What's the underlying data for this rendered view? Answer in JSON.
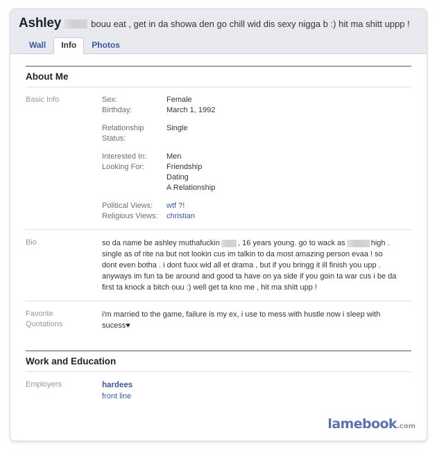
{
  "header": {
    "profile_name": "Ashley",
    "name_redacted": true,
    "status_text": "bouu eat , get in da showa den go chill wid dis sexy nigga b :) hit ma shitt uppp !",
    "tabs": [
      {
        "label": "Wall",
        "active": false
      },
      {
        "label": "Info",
        "active": true
      },
      {
        "label": "Photos",
        "active": false
      }
    ]
  },
  "sections": {
    "about_me": {
      "title": "About Me",
      "basic_info": {
        "label": "Basic Info",
        "groups": [
          {
            "items": [
              {
                "key": "Sex:",
                "value": "Female"
              },
              {
                "key": "Birthday:",
                "value": "March 1, 1992"
              }
            ]
          },
          {
            "items": [
              {
                "key": "Relationship Status:",
                "value": "Single"
              }
            ]
          },
          {
            "items": [
              {
                "key": "Interested In:",
                "value": "Men"
              },
              {
                "key": "Looking For:",
                "value": "Friendship"
              }
            ],
            "extra_values": [
              "Dating",
              "A Relationship"
            ]
          },
          {
            "items": [
              {
                "key": "Political Views:",
                "value": "wtf ?!",
                "link": true
              },
              {
                "key": "Religious Views:",
                "value": "christian",
                "link": true
              }
            ]
          }
        ]
      },
      "bio": {
        "label": "Bio",
        "part1": "so da name be ashley muthafuckin",
        "part2": ", 16 years young. go to wack as",
        "part3": "high . single as of rite na but not lookin cus im talkin to da most amazing person evaa ! so dont even botha . i dont fuxx wid all et drama , but if you bringg it ill finish you upp . anyways im fun ta be around and good ta have on ya side if you goin ta war cus i be da first ta knock a bitch ouu :) well get ta kno me , hit ma shitt upp !"
      },
      "favorite_quotations": {
        "label_line1": "Favorite",
        "label_line2": "Quotations",
        "text": "i'm married to the game, failure is my ex, i use to mess with hustle now i sleep with sucess",
        "heart": "♥"
      }
    },
    "work_and_education": {
      "title": "Work and Education",
      "employers": {
        "label": "Employers",
        "name": "hardees",
        "position": "front line"
      }
    }
  },
  "watermark": {
    "brand": "lamebook",
    "tld": ".com"
  },
  "colors": {
    "facebook_blue": "#3b5998",
    "header_band": "#e8eaf0",
    "label_gray": "#9097a5",
    "body_text": "#333333",
    "watermark_blue": "#5a71b0"
  }
}
